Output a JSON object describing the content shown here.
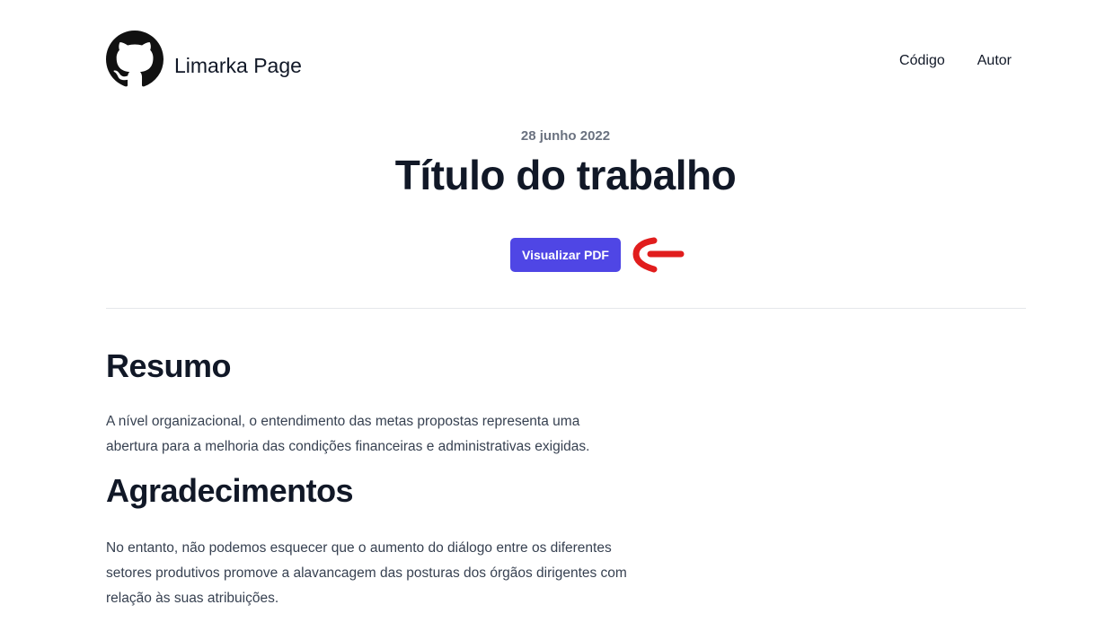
{
  "header": {
    "site_title": "Limarka Page",
    "logo_icon": "github-icon",
    "nav": [
      {
        "label": "Código"
      },
      {
        "label": "Autor"
      }
    ]
  },
  "article": {
    "date": "28 junho 2022",
    "title": "Título do trabalho",
    "pdf_button_label": "Visualizar PDF",
    "annotation_icon": "red-arrow-left-icon",
    "accent_color": "#4f46e5",
    "annotation_color": "#e11d1d"
  },
  "sections": [
    {
      "heading": "Resumo",
      "text": "A nível organizacional, o entendimento das metas propostas representa uma abertura para a melhoria das condições financeiras e administrativas exigidas."
    },
    {
      "heading": "Agradecimentos",
      "text": "No entanto, não podemos esquecer que o aumento do diálogo entre os diferentes setores produtivos promove a alavancagem das posturas dos órgãos dirigentes com relação às suas atribuições."
    }
  ]
}
